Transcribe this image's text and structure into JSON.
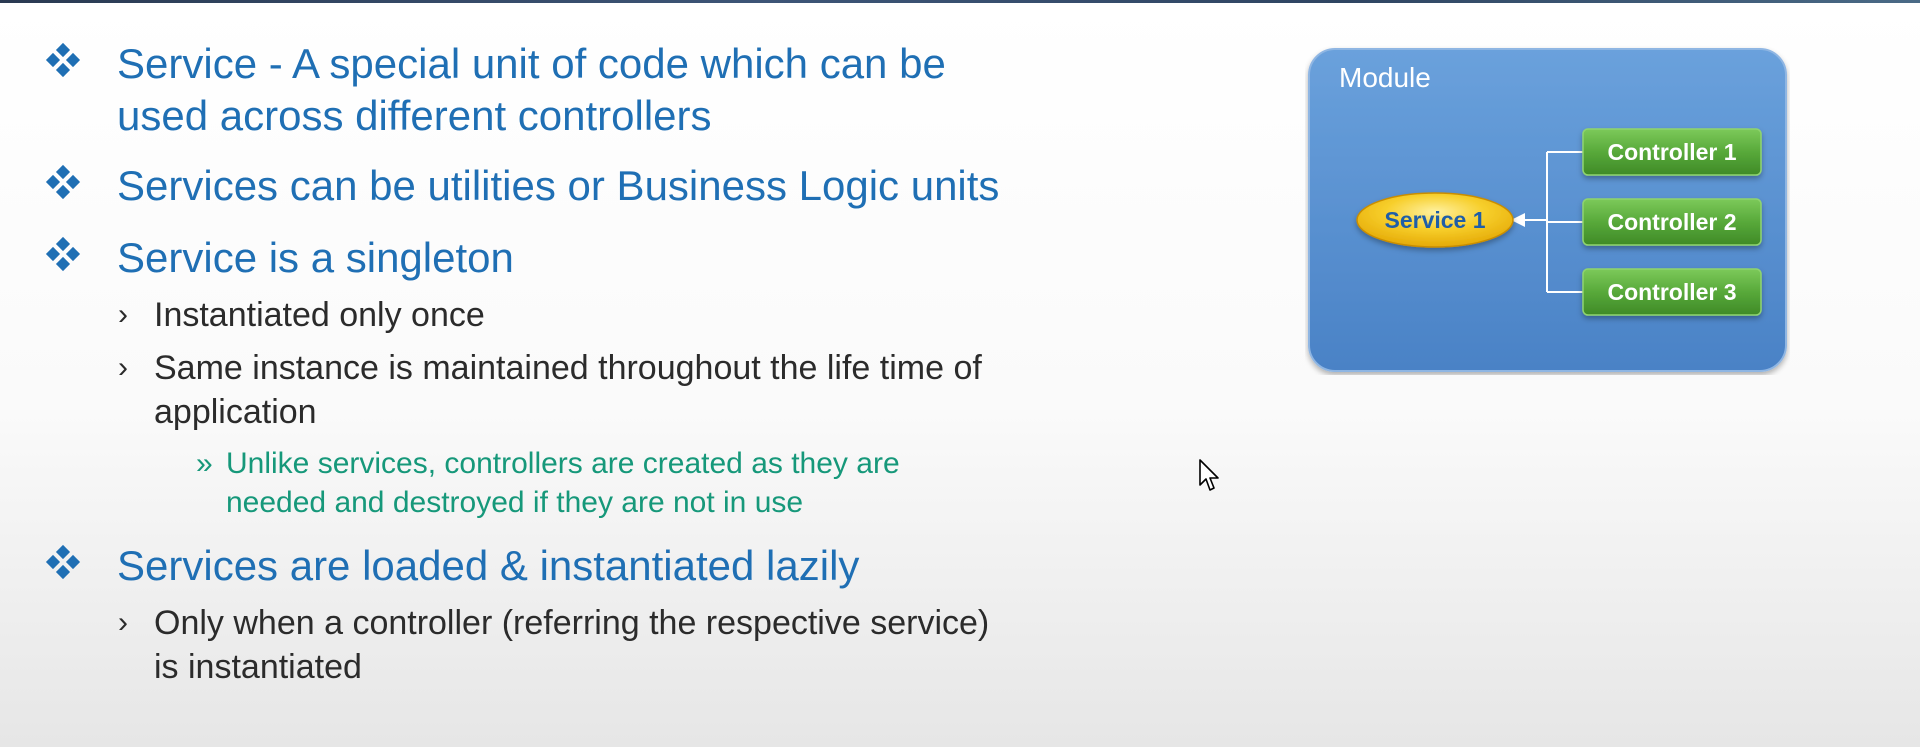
{
  "bullets": [
    {
      "lines": [
        "Service - A special unit of code which can be",
        "used across different controllers"
      ]
    },
    {
      "lines": [
        "Services can be utilities or Business Logic units"
      ]
    },
    {
      "lines": [
        "Service is a singleton"
      ]
    },
    {
      "lines": [
        "Services are loaded & instantiated lazily"
      ]
    }
  ],
  "sub_bullets": [
    {
      "lines": [
        "Instantiated only once"
      ]
    },
    {
      "lines": [
        "Same instance is maintained throughout the life time of",
        "application"
      ]
    },
    {
      "lines": [
        "Only when a controller (referring the respective service)",
        "is instantiated"
      ]
    }
  ],
  "note": {
    "lines": [
      "Unlike services, controllers are created as they are",
      "needed and destroyed if they are not in use"
    ]
  },
  "diagram": {
    "module_label": "Module",
    "service_label": "Service 1",
    "controllers": [
      "Controller 1",
      "Controller 2",
      "Controller 3"
    ]
  },
  "colors": {
    "heading": "#1f6fb4",
    "body_text": "#2b2b2b",
    "note_text": "#16987a",
    "module_fill": "#5b8fcf",
    "controller_fill": "#5cab3c",
    "service_fill": "#f3c21a",
    "service_text": "#1f5ea8"
  }
}
